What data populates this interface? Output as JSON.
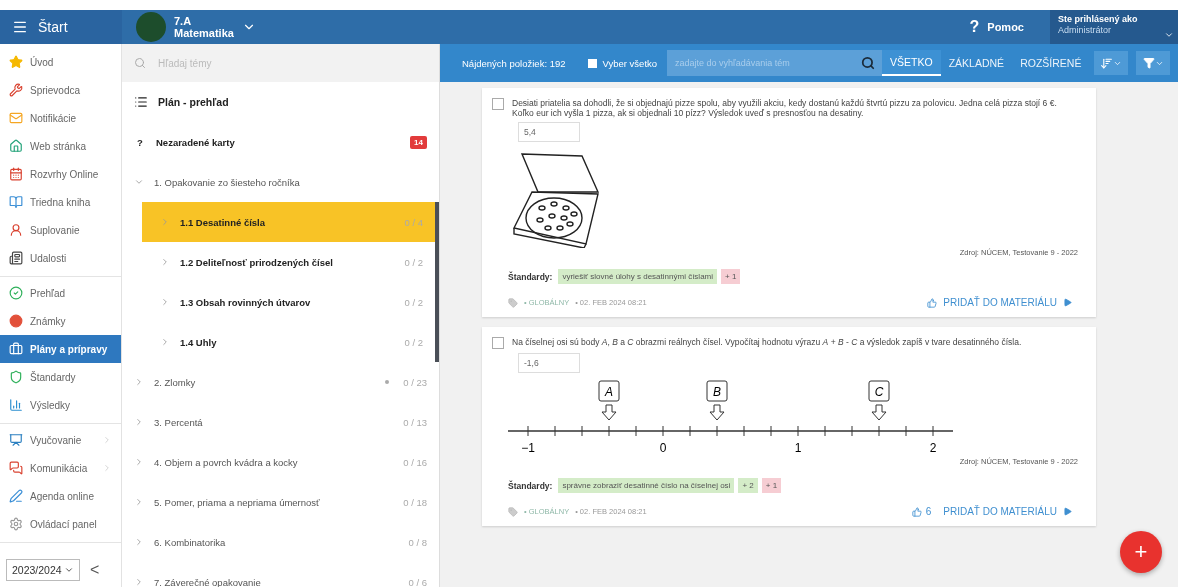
{
  "header": {
    "start": "Štart",
    "class_name": "7.A",
    "subject": "Matematika",
    "help_mark": "?",
    "help": "Pomoc",
    "user_caption": "Ste prihlásený ako",
    "user_role": "Administrátor"
  },
  "sidebar": {
    "sections": [
      {
        "items": [
          {
            "label": "Úvod",
            "selected": false
          },
          {
            "label": "Sprievodca",
            "selected": false
          },
          {
            "label": "Notifikácie",
            "selected": false
          },
          {
            "label": "Web stránka",
            "selected": false
          },
          {
            "label": "Rozvrhy Online",
            "selected": false
          },
          {
            "label": "Triedna kniha",
            "selected": false
          },
          {
            "label": "Suplovanie",
            "selected": false
          },
          {
            "label": "Udalosti",
            "selected": false
          }
        ]
      },
      {
        "items": [
          {
            "label": "Prehľad",
            "selected": false
          },
          {
            "label": "Známky",
            "selected": false
          },
          {
            "label": "Plány a prípravy",
            "selected": true
          },
          {
            "label": "Štandardy",
            "selected": false
          },
          {
            "label": "Výsledky",
            "selected": false
          }
        ]
      },
      {
        "items": [
          {
            "label": "Vyučovanie",
            "selected": false,
            "submenu": true
          },
          {
            "label": "Komunikácia",
            "selected": false,
            "submenu": true
          },
          {
            "label": "Agenda online",
            "selected": false,
            "submenu": false
          },
          {
            "label": "Ovládací panel",
            "selected": false,
            "submenu": false
          }
        ]
      }
    ],
    "year": "2023/2024",
    "collapse": "<"
  },
  "topics": {
    "search_placeholder": "Hľadaj témy",
    "overview": "Plán - prehľad",
    "unassigned": {
      "mark": "?",
      "label": "Nezaradené karty",
      "badge": "14"
    },
    "chapters": [
      {
        "label": "1. Opakovanie zo šiesteho ročníka",
        "expanded": true,
        "flagged": false,
        "children": [
          {
            "label": "1.1 Desatinné čísla",
            "count": "0 / 4",
            "selected": true
          },
          {
            "label": "1.2 Deliteľnosť prirodzených čísel",
            "count": "0 / 2",
            "selected": false
          },
          {
            "label": "1.3 Obsah rovinných útvarov",
            "count": "0 / 2",
            "selected": false
          },
          {
            "label": "1.4 Uhly",
            "count": "0 / 2",
            "selected": false
          }
        ]
      },
      {
        "label": "2. Zlomky",
        "expanded": false,
        "count": "0 / 23",
        "flagged": true
      },
      {
        "label": "3. Percentá",
        "expanded": false,
        "count": "0 / 13",
        "flagged": false
      },
      {
        "label": "4. Objem a povrch kvádra a kocky",
        "expanded": false,
        "count": "0 / 16",
        "flagged": false
      },
      {
        "label": "5. Pomer, priama a nepriama úmernosť",
        "expanded": false,
        "count": "0 / 18",
        "flagged": false
      },
      {
        "label": "6. Kombinatorika",
        "expanded": false,
        "count": "0 / 8",
        "flagged": false
      },
      {
        "label": "7. Záverečné opakovanie",
        "expanded": false,
        "count": "0 / 6",
        "flagged": false
      }
    ]
  },
  "toolbar": {
    "found": "Nájdených položiek: 192",
    "select_all": {
      "label": "Vyber všetko",
      "checked": false
    },
    "search_placeholder": "zadajte do vyhľadávania tém",
    "filters": [
      {
        "label": "VŠETKO",
        "selected": true
      },
      {
        "label": "ZÁKLADNÉ",
        "selected": false
      },
      {
        "label": "ROZŠÍRENÉ",
        "selected": false
      }
    ]
  },
  "cards": [
    {
      "kind": "pizza",
      "checked": false,
      "question": "Desiati priatelia sa dohodli, že si objednajú pizze spolu, aby využili akciu, kedy dostanú každú štvrtú pizzu za polovicu. Jedna celá pizza stojí 6 €. Koľko eur ich vyšla 1 pizza, ak si objednali 10 pízz? Výsledok uveď s presnosťou na desatiny.",
      "answer": "5,4",
      "source": "Zdroj: NÚCEM, Testovanie 9 - 2022",
      "standards_label": "Štandardy:",
      "tags": [
        {
          "text": "vyriešiť slovné úlohy s desatinnými číslami",
          "color": "#d4ecc8"
        },
        {
          "text": "+ 1",
          "color": "#f6cdd3"
        }
      ],
      "scope": "• GLOBÁLNY",
      "date": "• 02. FEB 2024 08:21",
      "add": "PRIDAŤ DO MATERIÁLU"
    },
    {
      "kind": "number-line",
      "checked": false,
      "question": "Na číselnej osi sú body *A*, *B* a *C* obrazmi reálnych čísel. Vypočítaj hodnotu výrazu *A* + *B* - *C* a výsledok zapíš v tvare desatinného čísla.",
      "answer": "-1,6",
      "source": "Zdroj: NÚCEM, Testovanie 9 - 2022",
      "standards_label": "Štandardy:",
      "points": [
        {
          "label": "A"
        },
        {
          "label": "B"
        },
        {
          "label": "C"
        }
      ],
      "axis_labels": [
        "−1",
        "0",
        "1",
        "2"
      ],
      "tags": [
        {
          "text": "správne zobraziť desatinné číslo na číselnej osi",
          "color": "#d4ecc8"
        },
        {
          "text": "+ 2",
          "color": "#d4ecc8"
        },
        {
          "text": "+ 1",
          "color": "#f6cdd3"
        }
      ],
      "scope": "• GLOBÁLNY",
      "date": "• 02. FEB 2024 08:21",
      "likes": "6",
      "add": "PRIDAŤ DO MATERIÁLU"
    }
  ],
  "fab": "+"
}
